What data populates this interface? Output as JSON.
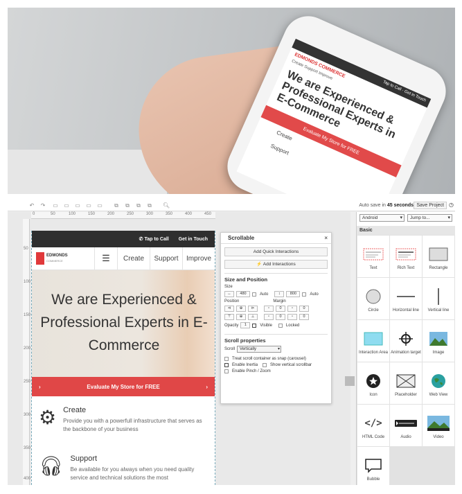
{
  "photo": {
    "brand": "EDMONDS COMMERCE",
    "top_links": [
      "Tap to Call",
      "Get in Touch"
    ],
    "nav": [
      "Create",
      "Support",
      "Improve"
    ],
    "headline": "We are Experienced & Professional Experts in E-Commerce",
    "cta": "Evaluate My Store for FREE",
    "features": [
      "Create",
      "Support"
    ]
  },
  "toolbar": {
    "autosave_prefix": "Auto save in",
    "autosave_time": "45 seconds",
    "save_project": "Save Project"
  },
  "ruler": {
    "h_ticks": [
      "0",
      "50",
      "100",
      "150",
      "200",
      "250",
      "300",
      "350",
      "400",
      "450"
    ],
    "v_ticks": [
      "50",
      "100",
      "150",
      "200",
      "250",
      "300",
      "350",
      "400"
    ]
  },
  "device": {
    "top_links": [
      "Tap to Call",
      "Get in Touch"
    ],
    "logo_name": "EDMONDS",
    "logo_sub": "COMMERCE",
    "nav": [
      "Create",
      "Support",
      "Improve"
    ],
    "hero": "We are Experienced & Professional Experts in E-Commerce",
    "cta": "Evaluate My Store for FREE",
    "features": [
      {
        "title": "Create",
        "desc": "Provide you with a powerfull infrastructure that serves as the backbone of your business"
      },
      {
        "title": "Support",
        "desc": "Be available for you always when you need quality service and technical solutions the most"
      }
    ]
  },
  "scrollable_panel": {
    "title": "Scrollable",
    "btn_quick": "Add Quick Interactions",
    "btn_interactions": "Add Interactions",
    "size_position": "Size and Position",
    "size_label": "Size",
    "width": "480",
    "auto": "Auto",
    "height": "800",
    "position_label": "Position",
    "margin_label": "Margin",
    "margin_values": [
      "0",
      "0",
      "0",
      "0"
    ],
    "opacity_label": "Opacity",
    "opacity_value": "1",
    "visible": "Visible",
    "locked": "Locked",
    "scroll_props": "Scroll properties",
    "scroll_label": "Scroll",
    "scroll_value": "Vertically",
    "opt_snap": "Treat scroll container as snap (carousel)",
    "opt_inertia": "Enable Inertia",
    "opt_show_scrollbar": "Show vertical scrollbar",
    "opt_pinch": "Enable Pinch / Zoom"
  },
  "right_panel": {
    "device_select": "Android",
    "jump_select": "Jump to...",
    "section": "Basic",
    "items": [
      "Text",
      "Rich Text",
      "Rectangle",
      "Circle",
      "Horizontal line",
      "Vertical line",
      "Interaction Area",
      "Animation target",
      "Image",
      "Icon",
      "Placeholder",
      "Web View",
      "HTML Code",
      "Audio",
      "Video",
      "Bubble"
    ]
  },
  "colors": {
    "accent_red": "#e04747",
    "dark_bar": "#2f2f2f"
  }
}
